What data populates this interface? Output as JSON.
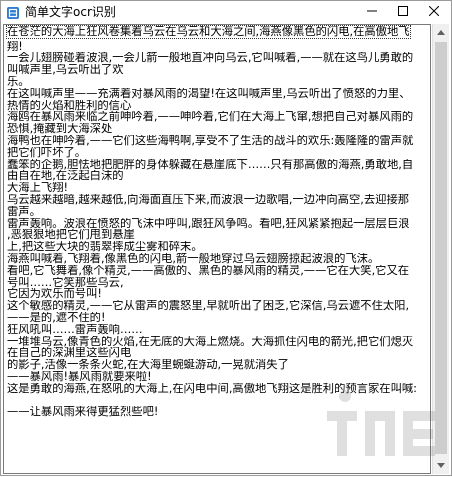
{
  "window": {
    "title": "简单文字ocr识别",
    "minimize_label": "—",
    "maximize_label": "☐",
    "close_label": "✕"
  },
  "ocr_text": {
    "lines": [
      "在苍茫的大海上狂风卷集着乌云在乌云和大海之间,海燕像黑色的闪电,在高傲地飞",
      "翔!",
      "一会儿翅膀碰着波浪,一会儿箭一般地直冲向乌云,它叫喊着,——就在这鸟儿勇敢的",
      "叫喊声里,乌云听出了欢",
      "乐。",
      "在这叫喊声里——充满着对暴风雨的渴望!在这叫喊声里,乌云听出了愤怒的力里、",
      "热情的火焰和胜利的信心",
      "海鸥在暴风雨来临之前呻吟着,——呻吟着,它们在大海上飞窜,想把自己对暴风雨的",
      "恐惧,掩藏到大海深处",
      "海鸭也在呻吟着,——它们这些海鸭啊,享受不了生活的战斗的欢乐:轰隆隆的雷声就",
      "把它们吓坏了。",
      "蠢笨的企鹅,胆怯地把肥胖的身体躲藏在悬崖底下……只有那高傲的海燕,勇敢地,自",
      "由自在地,在泛起白沫的",
      "大海上飞翔!",
      "乌云越来越暗,越来越低,向海面直压下来,而波浪一边歌唱,一边冲向高空,去迎接那",
      "雷声。",
      "雷声轰响。波浪在愤怒的飞沫中呼叫,跟狂风争鸣。看吧,狂风紧紧抱起一层层巨浪",
      ",恶狠狠地把它们甩到悬崖",
      "上,把这些大块的翡翠摔成尘雾和碎末。",
      "海燕叫喊着,飞翔着,像黑色的闪电,箭一般地穿过乌云翅膀掠起波浪的飞沫。",
      "看吧,它飞舞着,像个精灵,——高傲的、黑色的暴风雨的精灵,——它在大笑,它又在",
      "号叫……它笑那些乌云,",
      "它因为欢乐而号叫!",
      "这个敏感的精灵,——它从雷声的震怒里,早就听出了困乏,它深信,乌云遮不住太阳,",
      "——是的,遮不住的!",
      "狂风吼叫……雷声轰响……",
      "一堆堆乌云,像青色的火焰,在无底的大海上燃烧。大海抓住闪电的箭光,把它们熄灭",
      "在自己的深渊里这些闪电",
      "的影子,活像一条条火蛇,在大海里蜿蜒游动,一晃就消失了",
      "——暴风雨!暴风雨就要来啦!",
      "这是勇敢的海燕,在怒吼的大海上,在闪电中间,高傲地飞翔这是胜利的预言家在叫喊:",
      "",
      "——让暴风雨来得更猛烈些吧!"
    ]
  },
  "colors": {
    "border": "#9a9a9a",
    "scrollbar_track": "#f0f0f0",
    "scrollbar_thumb": "#cdcdcd",
    "app_icon": "#2b7cd3"
  },
  "icons": {
    "app": "ocr-app-icon",
    "minimize": "minimize-icon",
    "maximize": "maximize-icon",
    "close": "close-icon",
    "scroll_up": "scroll-up-arrow-icon",
    "scroll_down": "scroll-down-arrow-icon",
    "watermark": "site-logo-watermark"
  }
}
